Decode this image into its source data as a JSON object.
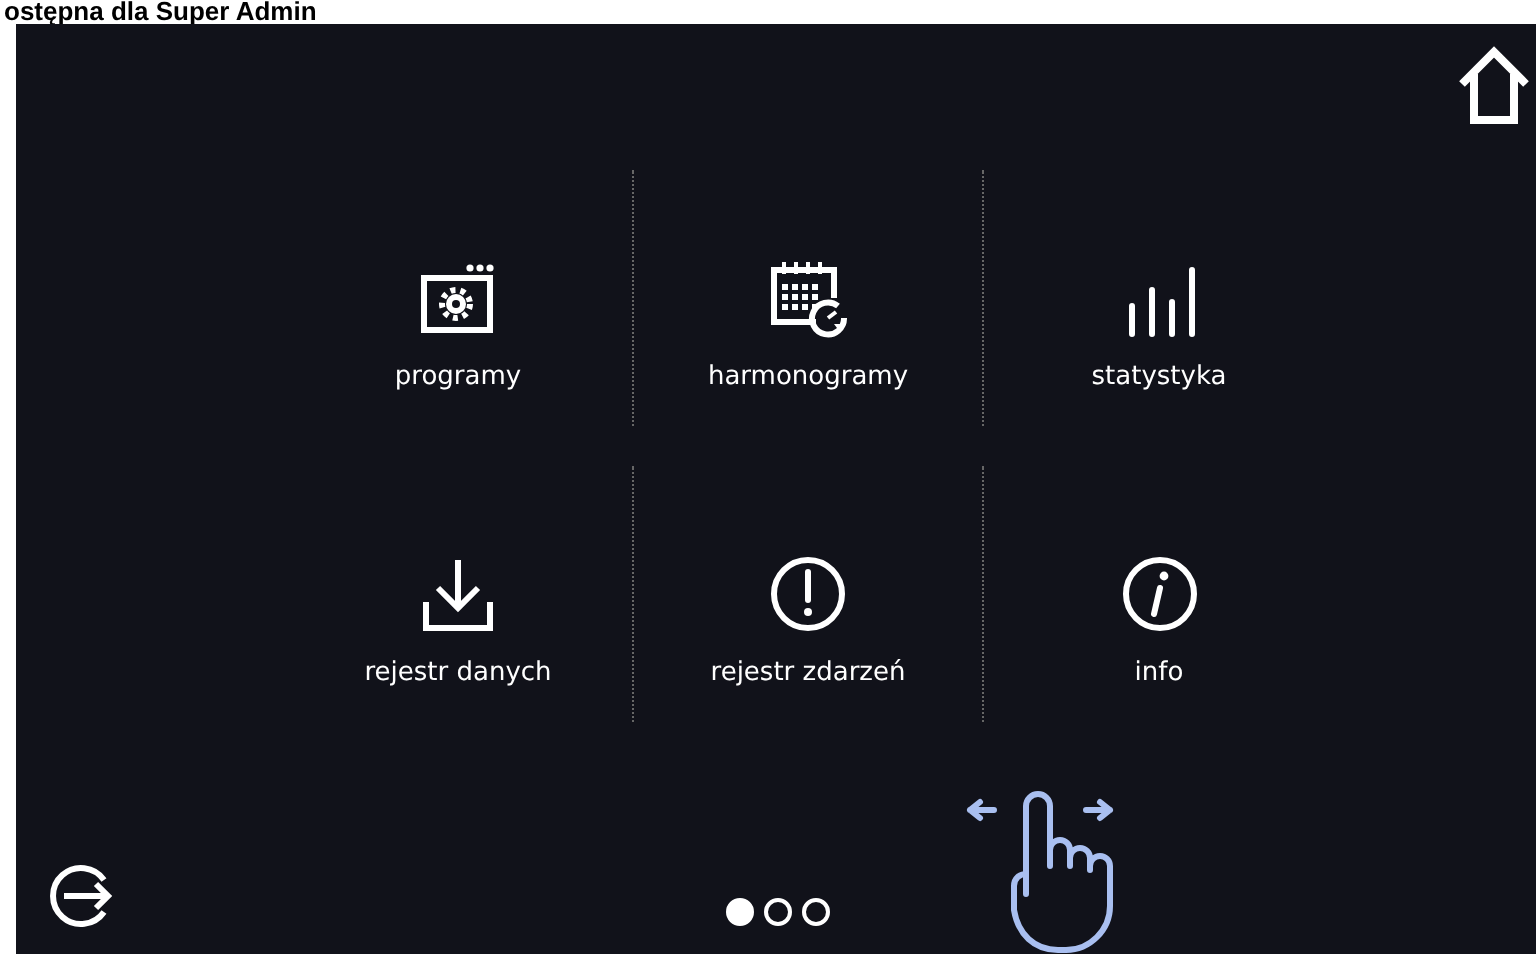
{
  "caption": "ostępna dla Super Admin",
  "menu": [
    {
      "label": "programy",
      "kind": "programs"
    },
    {
      "label": "harmonogramy",
      "kind": "schedule"
    },
    {
      "label": "statystyka",
      "kind": "stats"
    },
    {
      "label": "rejestr danych",
      "kind": "download"
    },
    {
      "label": "rejestr zdarzeń",
      "kind": "alert"
    },
    {
      "label": "info",
      "kind": "info"
    }
  ],
  "pages": [
    {
      "selected": true
    },
    {
      "selected": false
    },
    {
      "selected": false
    }
  ]
}
